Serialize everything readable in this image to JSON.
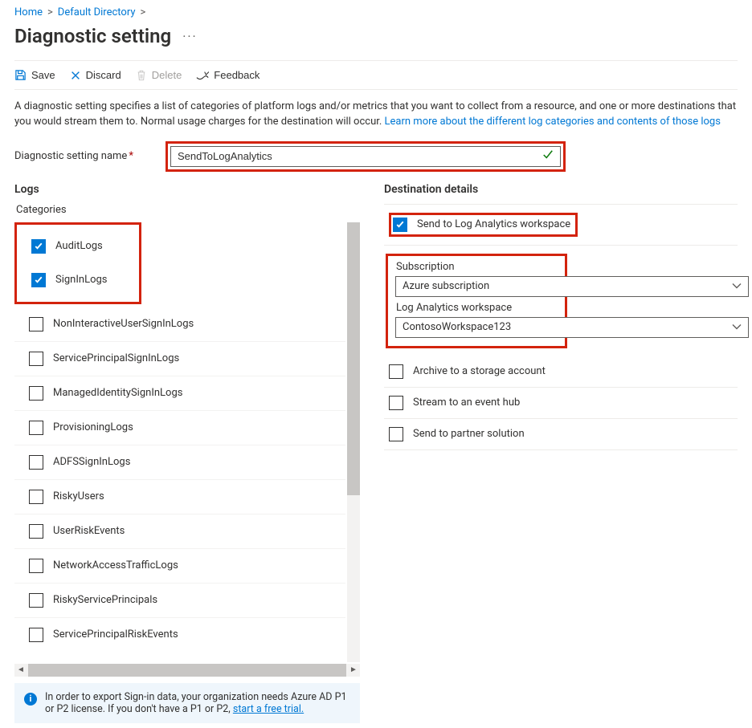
{
  "breadcrumb": {
    "home": "Home",
    "dir": "Default Directory"
  },
  "page": {
    "title": "Diagnostic setting"
  },
  "toolbar": {
    "save": "Save",
    "discard": "Discard",
    "delete": "Delete",
    "feedback": "Feedback"
  },
  "description": {
    "text": "A diagnostic setting specifies a list of categories of platform logs and/or metrics that you want to collect from a resource, and one or more destinations that you would stream them to. Normal usage charges for the destination will occur. ",
    "link": "Learn more about the different log categories and contents of those logs"
  },
  "name_field": {
    "label": "Diagnostic setting name",
    "value": "SendToLogAnalytics"
  },
  "logs": {
    "head": "Logs",
    "cat_head": "Categories",
    "items": [
      {
        "label": "AuditLogs",
        "checked": true
      },
      {
        "label": "SignInLogs",
        "checked": true
      },
      {
        "label": "NonInteractiveUserSignInLogs",
        "checked": false
      },
      {
        "label": "ServicePrincipalSignInLogs",
        "checked": false
      },
      {
        "label": "ManagedIdentitySignInLogs",
        "checked": false
      },
      {
        "label": "ProvisioningLogs",
        "checked": false
      },
      {
        "label": "ADFSSignInLogs",
        "checked": false
      },
      {
        "label": "RiskyUsers",
        "checked": false
      },
      {
        "label": "UserRiskEvents",
        "checked": false
      },
      {
        "label": "NetworkAccessTrafficLogs",
        "checked": false
      },
      {
        "label": "RiskyServicePrincipals",
        "checked": false
      },
      {
        "label": "ServicePrincipalRiskEvents",
        "checked": false
      }
    ]
  },
  "info": {
    "text": "In order to export Sign-in data, your organization needs Azure AD P1 or P2 license. If you don't have a P1 or P2, ",
    "link": "start a free trial."
  },
  "dest": {
    "head": "Destination details",
    "la": {
      "label": "Send to Log Analytics workspace",
      "checked": true
    },
    "sub_label": "Subscription",
    "sub_value": "Azure subscription",
    "ws_label": "Log Analytics workspace",
    "ws_value": "ContosoWorkspace123",
    "archive": {
      "label": "Archive to a storage account",
      "checked": false
    },
    "stream": {
      "label": "Stream to an event hub",
      "checked": false
    },
    "partner": {
      "label": "Send to partner solution",
      "checked": false
    }
  }
}
